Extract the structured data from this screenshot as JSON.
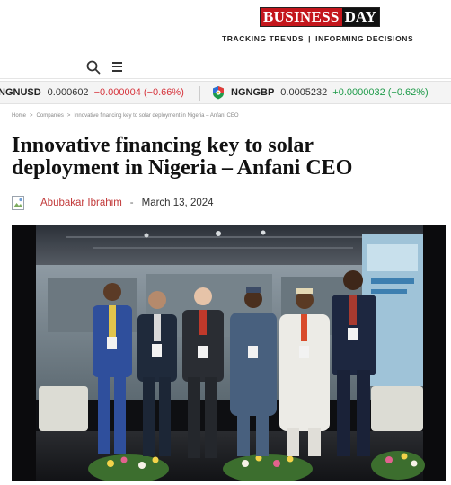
{
  "header": {
    "logo_part1": "BUSINESS",
    "logo_part2": "DAY",
    "tagline_left": "TRACKING TRENDS",
    "tagline_sep": "|",
    "tagline_right": "INFORMING DECISIONS"
  },
  "toolbar": {
    "search_icon": "search-icon",
    "menu_icon": "menu-icon"
  },
  "ticker": {
    "items": [
      {
        "symbol": "NGNUSD",
        "value": "0.000602",
        "change": "−0.000004 (−0.66%)",
        "direction": "down",
        "color": "#d6343c"
      },
      {
        "symbol": "NGNGBP",
        "value": "0.0005232",
        "change": "+0.0000032 (+0.62%)",
        "direction": "up",
        "color": "#1f9b4a"
      }
    ]
  },
  "breadcrumb": {
    "items": [
      "Home",
      "Companies",
      "Innovative financing key to solar deployment in Nigeria – Anfani CEO"
    ],
    "separator": ">"
  },
  "article": {
    "title": "Innovative financing key to solar deployment in Nigeria – Anfani CEO",
    "author": "Abubakar Ibrahim",
    "dash": "-",
    "date": "March 13, 2024"
  },
  "colors": {
    "brand_red": "#c4161c",
    "author_red": "#c23a3a",
    "positive": "#1f9b4a",
    "negative": "#d6343c"
  }
}
